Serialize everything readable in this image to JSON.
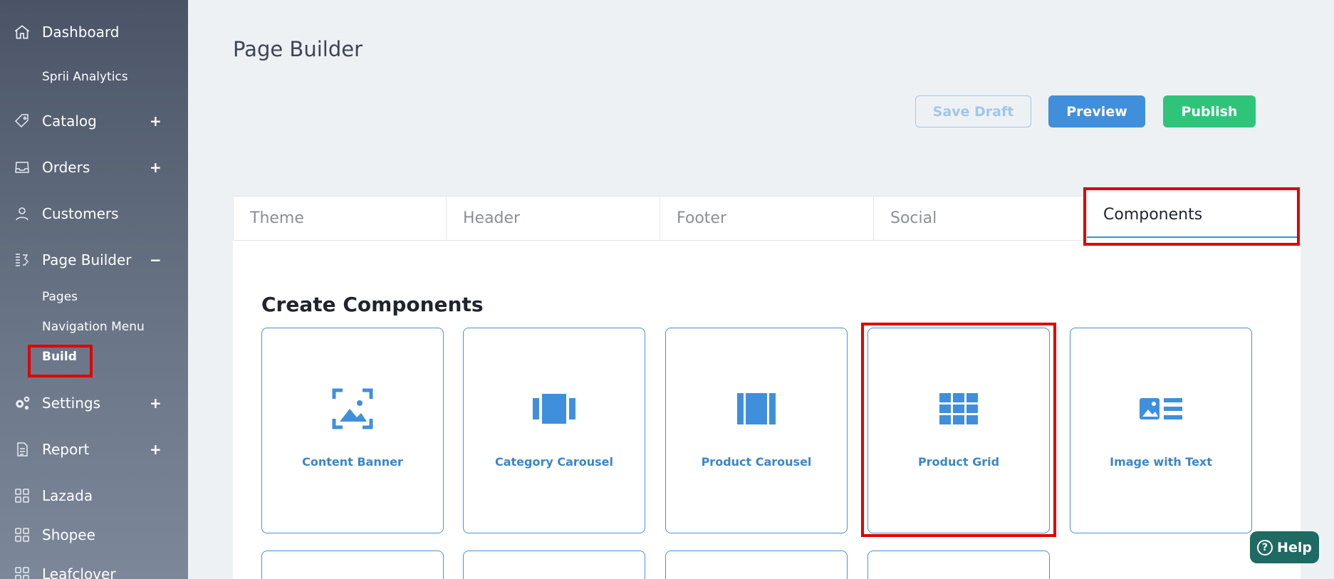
{
  "sidebar": {
    "items": {
      "dashboard": "Dashboard",
      "analytics": "Sprii Analytics",
      "catalog": "Catalog",
      "orders": "Orders",
      "customers": "Customers",
      "page_builder": "Page Builder",
      "settings": "Settings",
      "report": "Report",
      "lazada": "Lazada",
      "shopee": "Shopee",
      "leafclover": "Leafclover"
    },
    "toggles": {
      "plus": "+",
      "minus": "−"
    },
    "page_builder_sub": {
      "pages": "Pages",
      "navigation_menu": "Navigation Menu",
      "build": "Build"
    }
  },
  "header": {
    "title": "Page Builder",
    "save_draft": "Save Draft",
    "preview": "Preview",
    "publish": "Publish"
  },
  "tabs": {
    "theme": "Theme",
    "header": "Header",
    "footer": "Footer",
    "social": "Social",
    "components": "Components"
  },
  "main": {
    "section_title": "Create Components",
    "cards": {
      "content_banner": "Content Banner",
      "category_carousel": "Category Carousel",
      "product_carousel": "Product Carousel",
      "product_grid": "Product Grid",
      "image_with_text": "Image with Text"
    }
  },
  "help": {
    "label": "Help",
    "icon": "?"
  },
  "colors": {
    "accent": "#3f8fdc",
    "publish": "#2ec57b",
    "highlight": "#e00000",
    "help": "#1f6a62"
  }
}
